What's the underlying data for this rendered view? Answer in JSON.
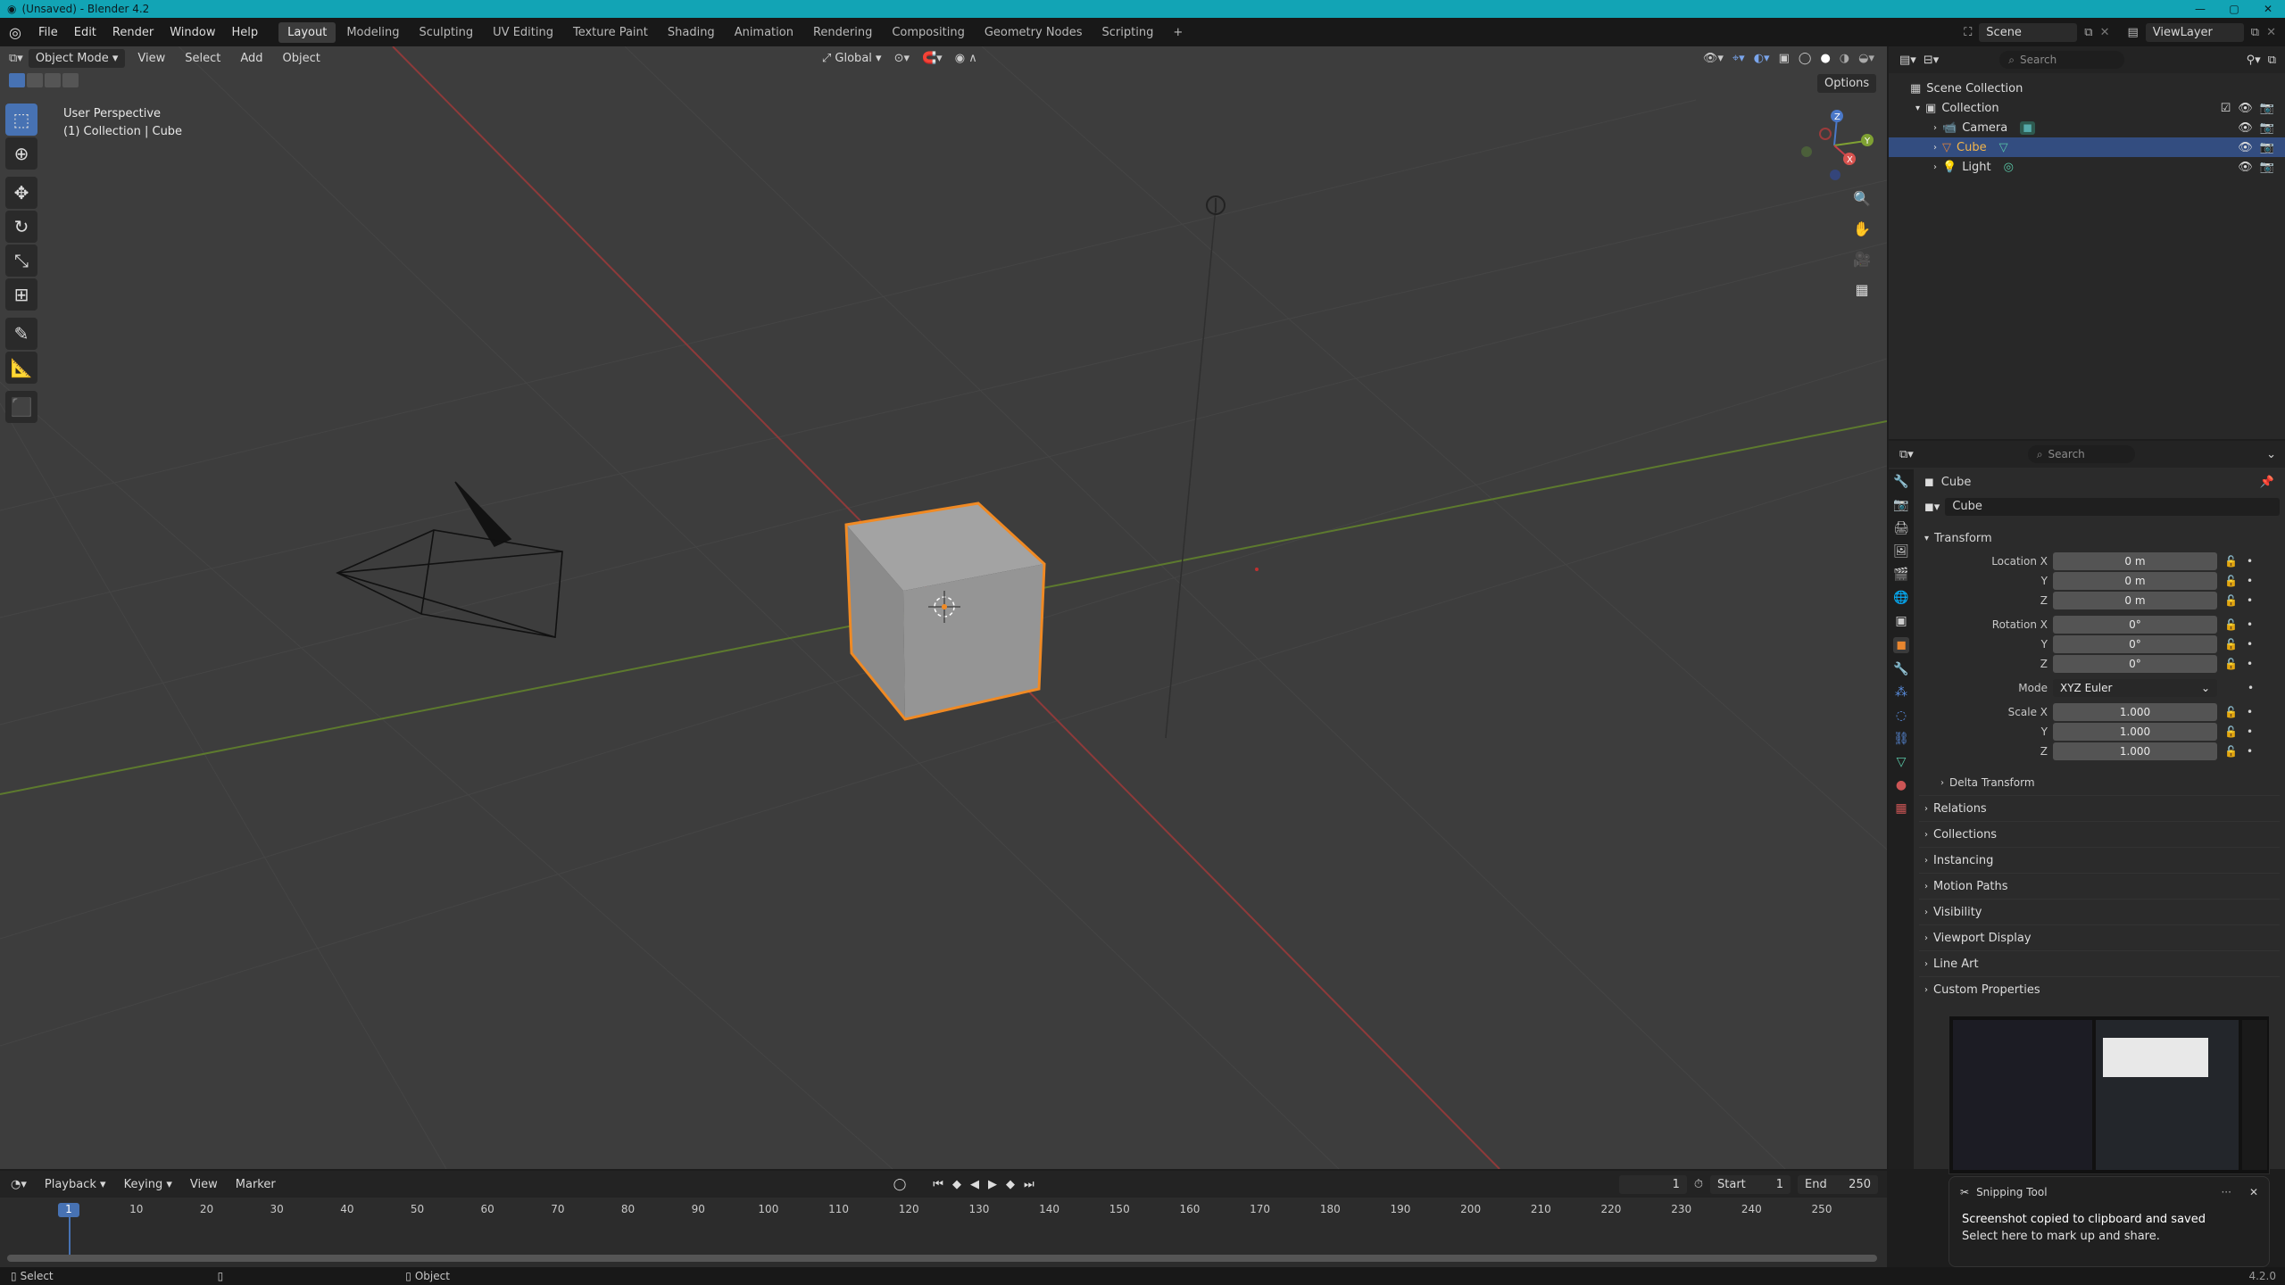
{
  "window": {
    "title": "(Unsaved) - Blender 4.2",
    "controls": [
      "—",
      "▢",
      "✕"
    ]
  },
  "menu": [
    "File",
    "Edit",
    "Render",
    "Window",
    "Help"
  ],
  "workspaces": [
    "Layout",
    "Modeling",
    "Sculpting",
    "UV Editing",
    "Texture Paint",
    "Shading",
    "Animation",
    "Rendering",
    "Compositing",
    "Geometry Nodes",
    "Scripting",
    "+"
  ],
  "active_workspace": "Layout",
  "topright": {
    "scene": "Scene",
    "view_layer": "ViewLayer"
  },
  "viewport_header": {
    "mode": "Object Mode",
    "menus": [
      "View",
      "Select",
      "Add",
      "Object"
    ],
    "orientation": "Global",
    "options": "Options"
  },
  "viewport_info": {
    "line1": "User Perspective",
    "line2": "(1) Collection | Cube"
  },
  "gizmo_axes": {
    "x": "X",
    "y": "Y",
    "z": "Z"
  },
  "outliner": {
    "search_placeholder": "Search",
    "scene_collection": "Scene Collection",
    "collection": "Collection",
    "items": [
      {
        "name": "Camera",
        "selected": false
      },
      {
        "name": "Cube",
        "selected": true
      },
      {
        "name": "Light",
        "selected": false
      }
    ]
  },
  "properties": {
    "search_placeholder": "Search",
    "object_name": "Cube",
    "data_name": "Cube",
    "transform_title": "Transform",
    "location": {
      "label": "Location X",
      "x": "0 m",
      "y": "0 m",
      "z": "0 m"
    },
    "rotation": {
      "label": "Rotation X",
      "x": "0°",
      "y": "0°",
      "z": "0°"
    },
    "mode": {
      "label": "Mode",
      "value": "XYZ Euler"
    },
    "scale": {
      "label": "Scale X",
      "x": "1.000",
      "y": "1.000",
      "z": "1.000"
    },
    "axis_labels": {
      "y": "Y",
      "z": "Z"
    },
    "delta": "Delta Transform",
    "sections": [
      "Relations",
      "Collections",
      "Instancing",
      "Motion Paths",
      "Visibility",
      "Viewport Display",
      "Line Art",
      "Custom Properties"
    ]
  },
  "timeline": {
    "menus": [
      "Playback",
      "Keying",
      "View",
      "Marker"
    ],
    "current_frame": "1",
    "start_label": "Start",
    "start": "1",
    "end_label": "End",
    "end": "250",
    "ticks": [
      "1",
      "10",
      "20",
      "30",
      "40",
      "50",
      "60",
      "70",
      "80",
      "90",
      "100",
      "110",
      "120",
      "130",
      "140",
      "150",
      "160",
      "170",
      "180",
      "190",
      "200",
      "210",
      "220",
      "230",
      "240",
      "250"
    ]
  },
  "statusbar": {
    "left": "Select",
    "middle": "Object",
    "version": "4.2.0"
  },
  "toast": {
    "app": "Snipping Tool",
    "title": "Screenshot copied to clipboard and saved",
    "body": "Select here to mark up and share.",
    "more": "···",
    "close": "✕"
  }
}
